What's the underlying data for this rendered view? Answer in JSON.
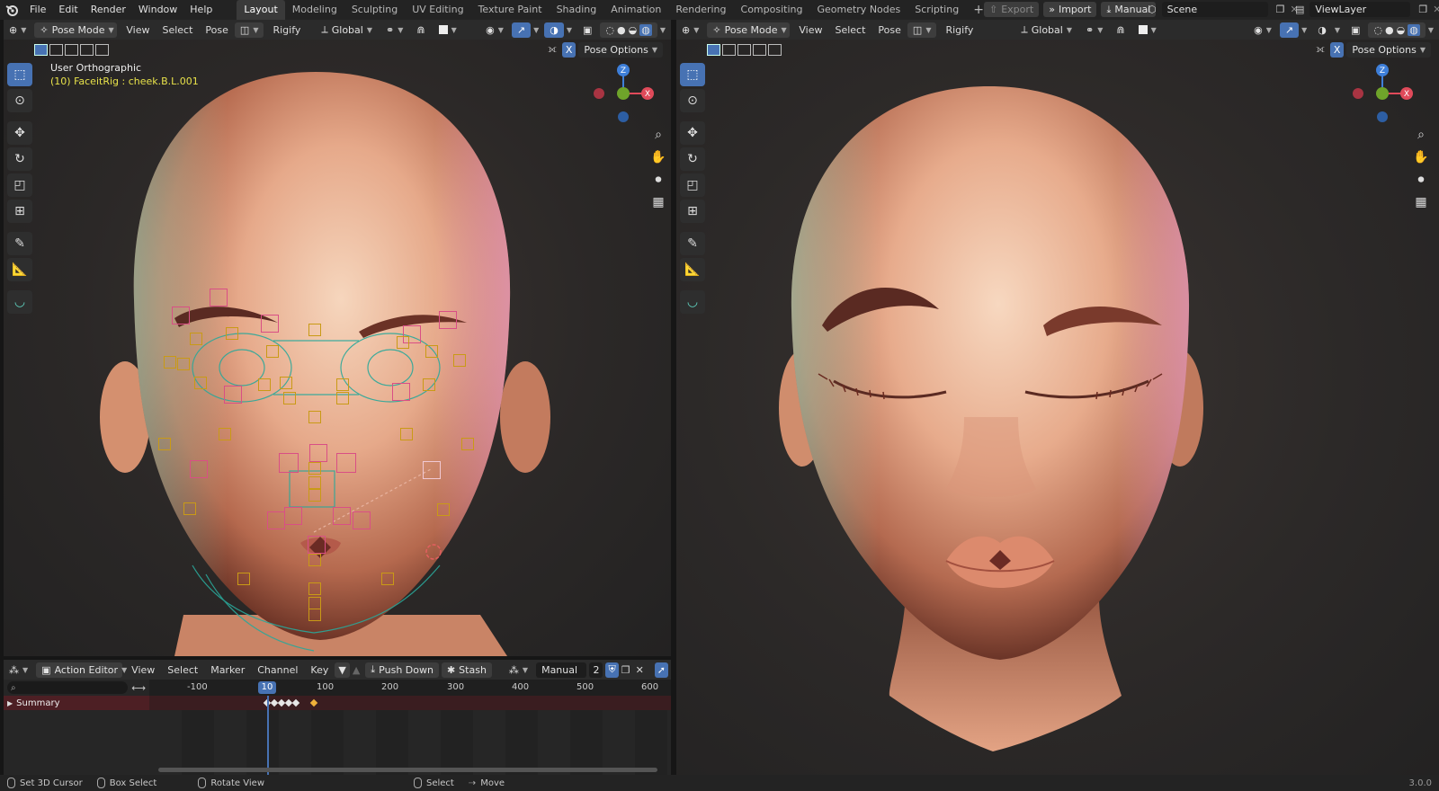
{
  "topbar": {
    "menus": [
      "File",
      "Edit",
      "Render",
      "Window",
      "Help"
    ],
    "workspaces": [
      {
        "label": "Layout",
        "active": true
      },
      {
        "label": "Modeling",
        "active": false
      },
      {
        "label": "Sculpting",
        "active": false
      },
      {
        "label": "UV Editing",
        "active": false
      },
      {
        "label": "Texture Paint",
        "active": false
      },
      {
        "label": "Shading",
        "active": false
      },
      {
        "label": "Animation",
        "active": false
      },
      {
        "label": "Rendering",
        "active": false
      },
      {
        "label": "Compositing",
        "active": false
      },
      {
        "label": "Geometry Nodes",
        "active": false
      },
      {
        "label": "Scripting",
        "active": false
      }
    ],
    "add_tab": "+",
    "export_label": "Export",
    "import_label": "Import",
    "manual_label": "Manual",
    "scene_value": "Scene",
    "viewlayer_value": "ViewLayer"
  },
  "viewport_left": {
    "mode": "Pose Mode",
    "menus": [
      "View",
      "Select",
      "Pose"
    ],
    "rigify": "Rigify",
    "transform": "Global",
    "x_label": "X",
    "pose_options": "Pose Options",
    "view_name": "User Orthographic",
    "active_bone": "(10) FaceitRig : cheek.B.L.001",
    "axes": {
      "z": "Z",
      "x": "X"
    }
  },
  "viewport_right": {
    "mode": "Pose Mode",
    "menus": [
      "View",
      "Select",
      "Pose"
    ],
    "rigify": "Rigify",
    "transform": "Global",
    "x_label": "X",
    "pose_options": "Pose Options",
    "axes": {
      "z": "Z",
      "x": "X"
    }
  },
  "action_editor": {
    "mode": "Action Editor",
    "menus": [
      "View",
      "Select",
      "Marker",
      "Channel",
      "Key"
    ],
    "push_down": "Push Down",
    "stash": "Stash",
    "action_name": "Manual",
    "users": "2",
    "ruler": [
      "-100",
      "100",
      "200",
      "300",
      "400",
      "500",
      "600"
    ],
    "current_frame": "10",
    "channel": "Summary"
  },
  "statusbar": {
    "items": [
      "Set 3D Cursor",
      "Box Select",
      "Rotate View",
      "Select",
      "Move"
    ],
    "version": "3.0.0"
  },
  "colors": {
    "accent": "#4772b3",
    "bone_selected": "#d94f85",
    "bone_unselected": "#c99a16",
    "rig_lines": "#2aa89a",
    "text_yellow": "#e8e24a"
  }
}
